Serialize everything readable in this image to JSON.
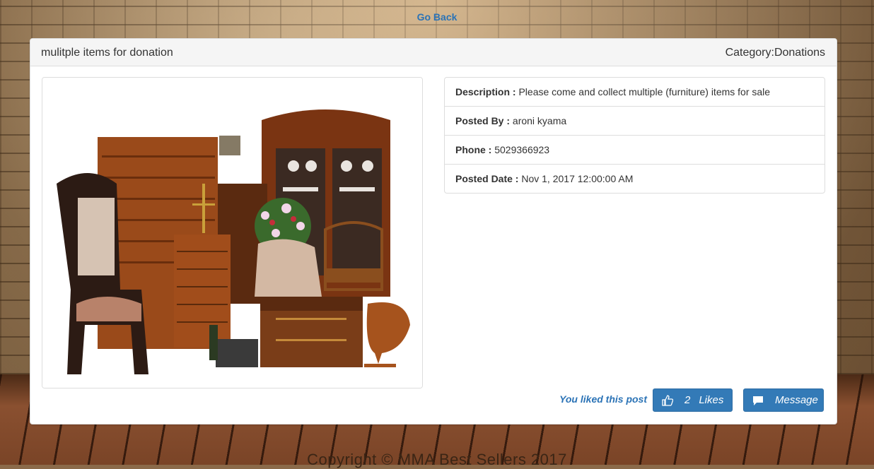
{
  "nav": {
    "go_back": "Go Back"
  },
  "post": {
    "title": "mulitple items for donation",
    "category": "Category:Donations",
    "image_alt": "furniture-photo"
  },
  "details": [
    {
      "label": "Description : ",
      "value": "Please come and collect multiple (furniture) items for sale"
    },
    {
      "label": "Posted By : ",
      "value": "aroni kyama"
    },
    {
      "label": "Phone : ",
      "value": "5029366923"
    },
    {
      "label": "Posted Date : ",
      "value": "Nov 1, 2017 12:00:00 AM"
    }
  ],
  "actions": {
    "liked_text": "You liked this post",
    "like_count": "2",
    "like_label": "Likes",
    "message_label": "Message"
  },
  "footer": {
    "copyright": "Copyright © MMA Best Sellers 2017"
  },
  "colors": {
    "accent": "#337ab7",
    "link": "#2b73b6"
  }
}
